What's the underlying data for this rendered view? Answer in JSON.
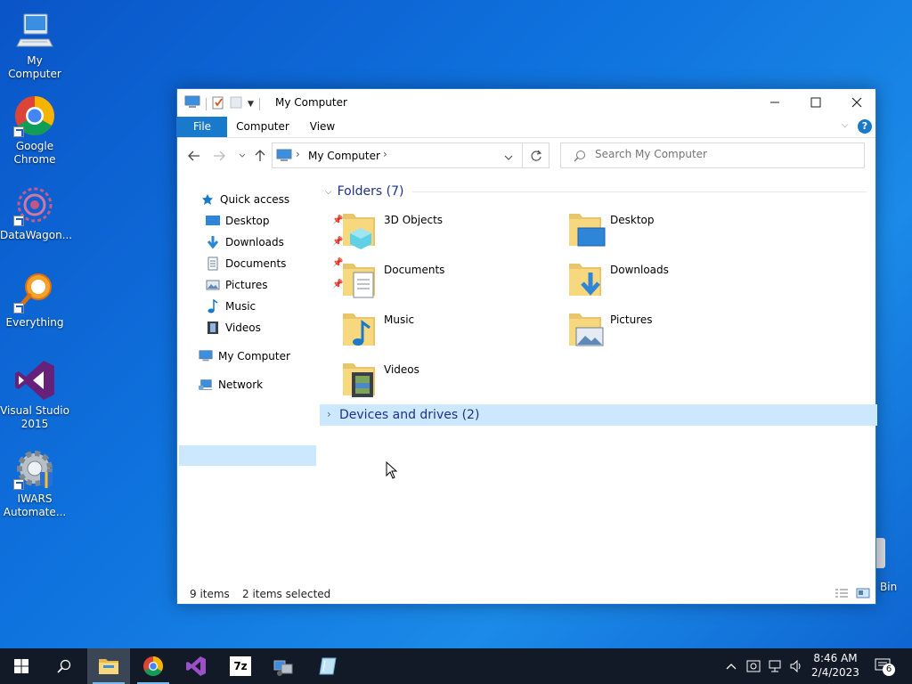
{
  "desktop": {
    "icons": [
      {
        "label": "My Computer"
      },
      {
        "label": "Google Chrome"
      },
      {
        "label": "DataWagon..."
      },
      {
        "label": "Everything"
      },
      {
        "label": "Visual Studio 2015"
      },
      {
        "label": "IWARS Automate..."
      }
    ],
    "recycle_bin_label": "Bin"
  },
  "window": {
    "title": "My Computer",
    "tabs": [
      "File",
      "Computer",
      "View"
    ],
    "address": {
      "location": "My Computer"
    },
    "search": {
      "placeholder": "Search My Computer"
    },
    "nav": {
      "quick_access": "Quick access",
      "items": [
        {
          "label": "Desktop",
          "pinned": true
        },
        {
          "label": "Downloads",
          "pinned": true
        },
        {
          "label": "Documents",
          "pinned": true
        },
        {
          "label": "Pictures",
          "pinned": true
        },
        {
          "label": "Music",
          "pinned": false
        },
        {
          "label": "Videos",
          "pinned": false
        }
      ],
      "my_computer": "My Computer",
      "network": "Network"
    },
    "folders_group": "Folders (7)",
    "folders": [
      {
        "label": "3D Objects"
      },
      {
        "label": "Desktop"
      },
      {
        "label": "Documents"
      },
      {
        "label": "Downloads"
      },
      {
        "label": "Music"
      },
      {
        "label": "Pictures"
      },
      {
        "label": "Videos"
      }
    ],
    "drives_group": "Devices and drives (2)",
    "status": {
      "items": "9 items",
      "selected": "2 items selected"
    }
  },
  "taskbar": {
    "clock_time": "8:46 AM",
    "clock_date": "2/4/2023",
    "notification_count": "6",
    "seven_zip_label": "7z"
  },
  "colors": {
    "accent": "#1979ca",
    "selection": "#cce8ff",
    "taskbar": "#111a26"
  }
}
